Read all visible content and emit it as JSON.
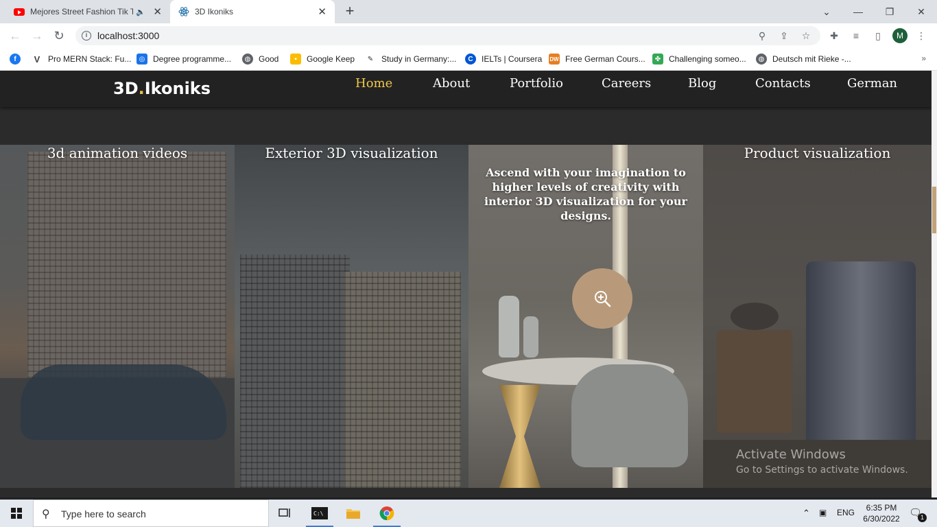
{
  "browser": {
    "tabs": [
      {
        "title": "Mejores Street Fashion Tik To",
        "icon": "youtube-icon"
      },
      {
        "title": "3D Ikoniks",
        "icon": "react-icon"
      }
    ],
    "url": "localhost:3000",
    "profile_initial": "M",
    "bookmarks": [
      {
        "label": "",
        "icon": "facebook-icon",
        "color": "#1877f2"
      },
      {
        "label": "Pro MERN Stack: Fu...",
        "icon": "v-icon",
        "color": "#444444"
      },
      {
        "label": "Degree programme...",
        "icon": "daad-icon",
        "color": "#1a73e8"
      },
      {
        "label": "Good",
        "icon": "globe-icon",
        "color": "#5f6368"
      },
      {
        "label": "Google Keep",
        "icon": "keep-icon",
        "color": "#fbbc04"
      },
      {
        "label": "Study in Germany:...",
        "icon": "study-icon",
        "color": "#333333"
      },
      {
        "label": "IELTs | Coursera",
        "icon": "coursera-icon",
        "color": "#0056d2"
      },
      {
        "label": "Free German Cours...",
        "icon": "dw-icon",
        "color": "#e67e22"
      },
      {
        "label": "Challenging someo...",
        "icon": "grid-icon",
        "color": "#34a853"
      },
      {
        "label": "Deutsch mit Rieke -...",
        "icon": "globe-icon",
        "color": "#5f6368"
      }
    ]
  },
  "site": {
    "logo_main": "3D",
    "logo_dot": ".",
    "logo_rest": "Ikoniks",
    "nav": [
      "Home",
      "About",
      "Portfolio",
      "Careers",
      "Blog",
      "Contacts",
      "German"
    ],
    "active_nav": "Home",
    "panels": [
      {
        "title": "3d animation videos"
      },
      {
        "title": "Exterior 3D visualization"
      },
      {
        "title": "",
        "description": "Ascend with your imagination to higher levels of creativity with interior 3D visualization for your designs."
      },
      {
        "title": "Product visualization"
      }
    ],
    "accent_color": "#f2c94c",
    "zoom_button_color": "#b89a7a"
  },
  "watermark": {
    "line1": "Activate Windows",
    "line2": "Go to Settings to activate Windows."
  },
  "taskbar": {
    "search_placeholder": "Type here to search",
    "language": "ENG",
    "time": "6:35 PM",
    "date": "6/30/2022",
    "notification_count": "1"
  }
}
